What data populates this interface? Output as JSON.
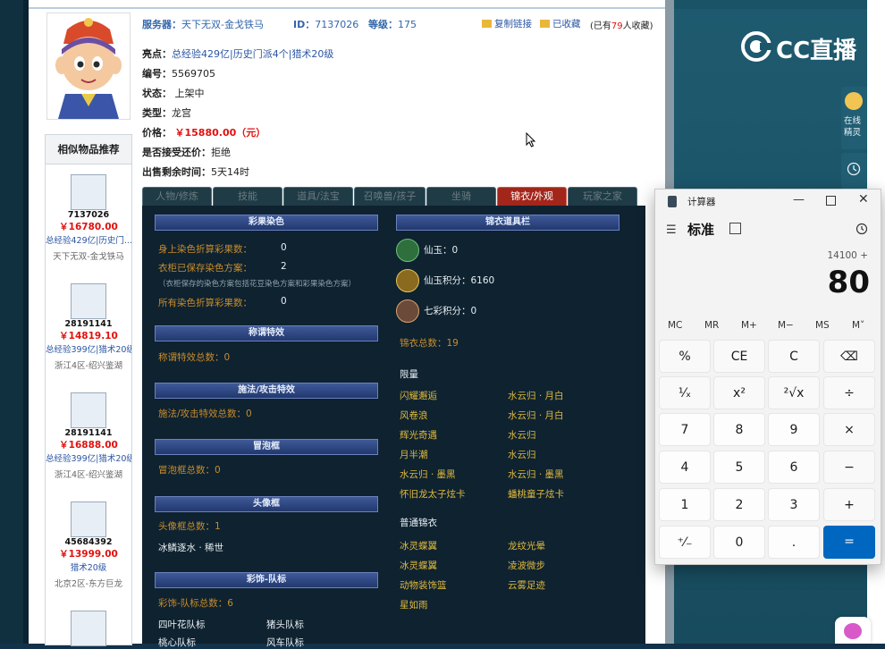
{
  "header": {
    "server_label": "服务器：",
    "server_value": "天下无双-金戈铁马",
    "id_label": "ID：",
    "id_value": "7137026",
    "level_label": "等级：",
    "level_value": "175",
    "copy_link": "复制链接",
    "favorited": "已收藏",
    "fav_count_prefix": "(已有",
    "fav_count": "79",
    "fav_count_suffix": "人收藏)"
  },
  "details": {
    "highlight_label": "亮点：",
    "highlight_items": [
      "总经验429亿",
      "历史门派4个",
      "猎术20级"
    ],
    "sep": "|",
    "number_label": "编号：",
    "number_value": "5569705",
    "status_label": "状态：",
    "status_value": "上架中",
    "type_label": "类型：",
    "type_value": "龙宫",
    "price_label": "价格：",
    "price_value": "￥15880.00（元）",
    "bargain_label": "是否接受还价：",
    "bargain_value": "拒绝",
    "remaining_label": "出售剩余时间：",
    "remaining_value": "5天14时"
  },
  "recommend": {
    "title": "相似物品推荐",
    "items": [
      {
        "id": "7137026",
        "price": "￥16780.00",
        "tags": "总经验429亿|历史门...",
        "server": "天下无双-金戈铁马"
      },
      {
        "id": "28191141",
        "price": "￥14819.10",
        "tags": "总经验399亿|猎术20级",
        "server": "浙江4区-绍兴鉴湖"
      },
      {
        "id": "28191141",
        "price": "￥16888.00",
        "tags": "总经验399亿|猎术20级",
        "server": "浙江4区-绍兴鉴湖"
      },
      {
        "id": "45684392",
        "price": "￥13999.00",
        "tags": "猎术20级",
        "server": "北京2区-东方巨龙"
      }
    ]
  },
  "tabs": [
    "人物/修炼",
    "技能",
    "道具/法宝",
    "召唤兽/孩子",
    "坐骑",
    "锦衣/外观",
    "玩家之家"
  ],
  "panel": {
    "dye_title": "彩果染色",
    "dye_rows": [
      {
        "label": "身上染色折算彩果数：",
        "value": "0"
      },
      {
        "label": "衣柜已保存染色方案：",
        "value": "2"
      }
    ],
    "dye_note": "（衣柜保存的染色方案包括花豆染色方案和彩果染色方案）",
    "dye_total_label": "所有染色折算彩果数：",
    "dye_total_value": "0",
    "title_fx_title": "称谓特效",
    "title_fx_total": "称谓特效总数：0",
    "spell_fx_title": "施法/攻击特效",
    "spell_fx_total": "施法/攻击特效总数：0",
    "bubble_title": "冒泡框",
    "bubble_total": "冒泡框总数：0",
    "avatar_frame_title": "头像框",
    "avatar_frame_total": "头像框总数：1",
    "avatar_frame_item": "冰鳞逐水 · 稀世",
    "team_title": "彩饰-队标",
    "team_total": "彩饰-队标总数：6",
    "team_items": [
      "四叶花队标",
      "猪头队标",
      "桃心队标",
      "风车队标"
    ],
    "wardrobe_title": "锦衣道具栏",
    "xianyu_label": "仙玉：0",
    "xianyu_points_label": "仙玉积分：6160",
    "qicai_points_label": "七彩积分：0",
    "jinyi_total": "锦衣总数：19",
    "limited_title": "限量",
    "limited_items": [
      [
        "闪耀邂逅",
        "水云归 · 月白"
      ],
      [
        "风卷浪",
        "水云归 · 月白"
      ],
      [
        "辉光奇遇",
        "水云归"
      ],
      [
        "月半潮",
        "水云归"
      ],
      [
        "水云归 · 墨黑",
        "水云归 · 墨黑"
      ],
      [
        "怀旧龙太子炫卡",
        "蟠桃童子炫卡"
      ]
    ],
    "normal_title": "普通锦衣",
    "normal_items": [
      [
        "冰灵蝶翼",
        "龙纹光晕"
      ],
      [
        "冰灵蝶翼",
        "凌波微步"
      ],
      [
        "动物装饰篮",
        "云雾足迹"
      ],
      [
        "星如雨",
        ""
      ]
    ]
  },
  "right_panel": {
    "logo": "CC直播",
    "side_label_1": "在线\n精灵",
    "side_label_2": "最近"
  },
  "calculator": {
    "window_title": "计算器",
    "mode": "标准",
    "expression": "14100 +",
    "display": "80",
    "memory": [
      "MC",
      "MR",
      "M+",
      "M−",
      "MS",
      "M˅"
    ],
    "keys": [
      [
        "%",
        "CE",
        "C",
        "⌫"
      ],
      [
        "¹⁄ₓ",
        "x²",
        "²√x",
        "÷"
      ],
      [
        "7",
        "8",
        "9",
        "×"
      ],
      [
        "4",
        "5",
        "6",
        "−"
      ],
      [
        "1",
        "2",
        "3",
        "+"
      ],
      [
        "⁺⁄₋",
        "0",
        ".",
        "="
      ]
    ]
  },
  "colors": {
    "accent": "#0067c0",
    "price_red": "#e0110e",
    "active_tab": "#a3261b",
    "panel_bg": "#0e2230"
  }
}
